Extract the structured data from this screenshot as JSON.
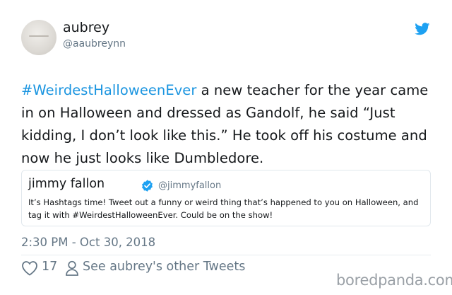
{
  "author": {
    "name": "aubrey",
    "handle": "@aaubreynn",
    "avatar_icon": "avatar-image"
  },
  "platform_icon": "twitter-bird-icon",
  "tweet": {
    "hashtag": "#WeirdestHalloweenEver",
    "body": " a new teacher for the year came in on Halloween and dressed as Gandolf, he said “Just kidding, I don’t look like this.” He took off his costume and now he just looks like Dumbledore.",
    "hashtag_color": "#1b95e0"
  },
  "quoted_tweet": {
    "name": "jimmy fallon",
    "handle": "@jimmyfallon",
    "verified_icon": "verified-badge-icon",
    "text": "It’s Hashtags time! Tweet out a funny or weird thing that’s happened to you on Halloween, and tag it with #WeirdestHalloweenEver. Could be on the show!"
  },
  "timestamp": "2:30 PM - Oct 30, 2018",
  "actions": {
    "like_icon": "heart-icon",
    "like_count": "17",
    "profile_icon": "person-icon",
    "other_tweets_label": "See aubrey's other Tweets"
  },
  "watermark": "boredpanda.com",
  "colors": {
    "text": "#14171a",
    "secondary": "#657786",
    "link": "#1b95e0",
    "twitter_blue": "#1da1f2",
    "border": "#e1e8ed"
  }
}
